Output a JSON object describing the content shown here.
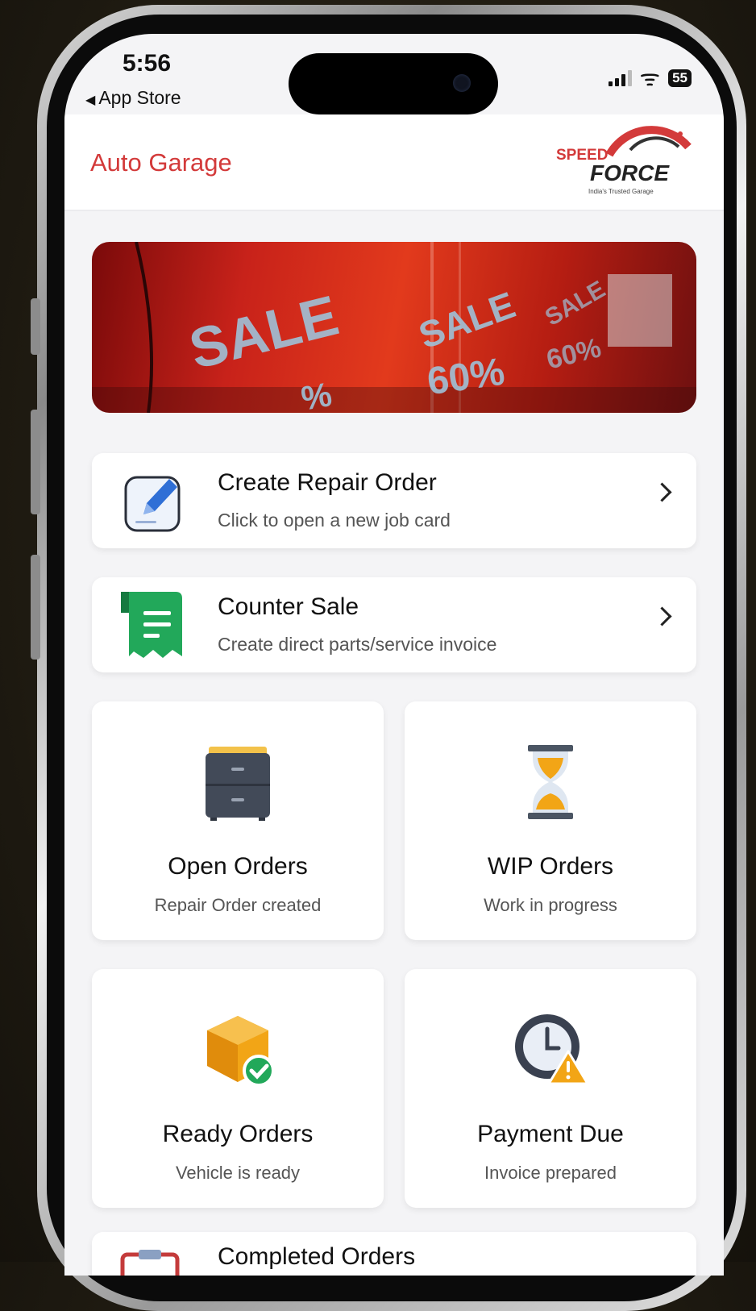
{
  "status_bar": {
    "time": "5:56",
    "back_label": "App Store",
    "battery": "55"
  },
  "header": {
    "title": "Auto Garage",
    "logo_top": "SPEED",
    "logo_bottom": "FORCE",
    "logo_tagline": "India's Trusted Garage"
  },
  "banner": {
    "words": [
      "SALE",
      "SALE",
      "SALE",
      "60%",
      "60%",
      "%"
    ]
  },
  "actions": [
    {
      "title": "Create Repair Order",
      "subtitle": "Click to open a new job card",
      "icon": "edit-pencil-icon"
    },
    {
      "title": "Counter Sale",
      "subtitle": "Create direct parts/service invoice",
      "icon": "invoice-receipt-icon"
    }
  ],
  "tiles": [
    {
      "title": "Open Orders",
      "subtitle": "Repair Order created",
      "icon": "file-cabinet-icon"
    },
    {
      "title": "WIP Orders",
      "subtitle": "Work in progress",
      "icon": "hourglass-icon"
    },
    {
      "title": "Ready Orders",
      "subtitle": "Vehicle is ready",
      "icon": "package-check-icon"
    },
    {
      "title": "Payment Due",
      "subtitle": "Invoice prepared",
      "icon": "clock-warning-icon"
    }
  ],
  "completed": {
    "title": "Completed Orders"
  },
  "colors": {
    "brand_red": "#d33a3a",
    "green": "#22a85a",
    "amber": "#f2a516"
  }
}
